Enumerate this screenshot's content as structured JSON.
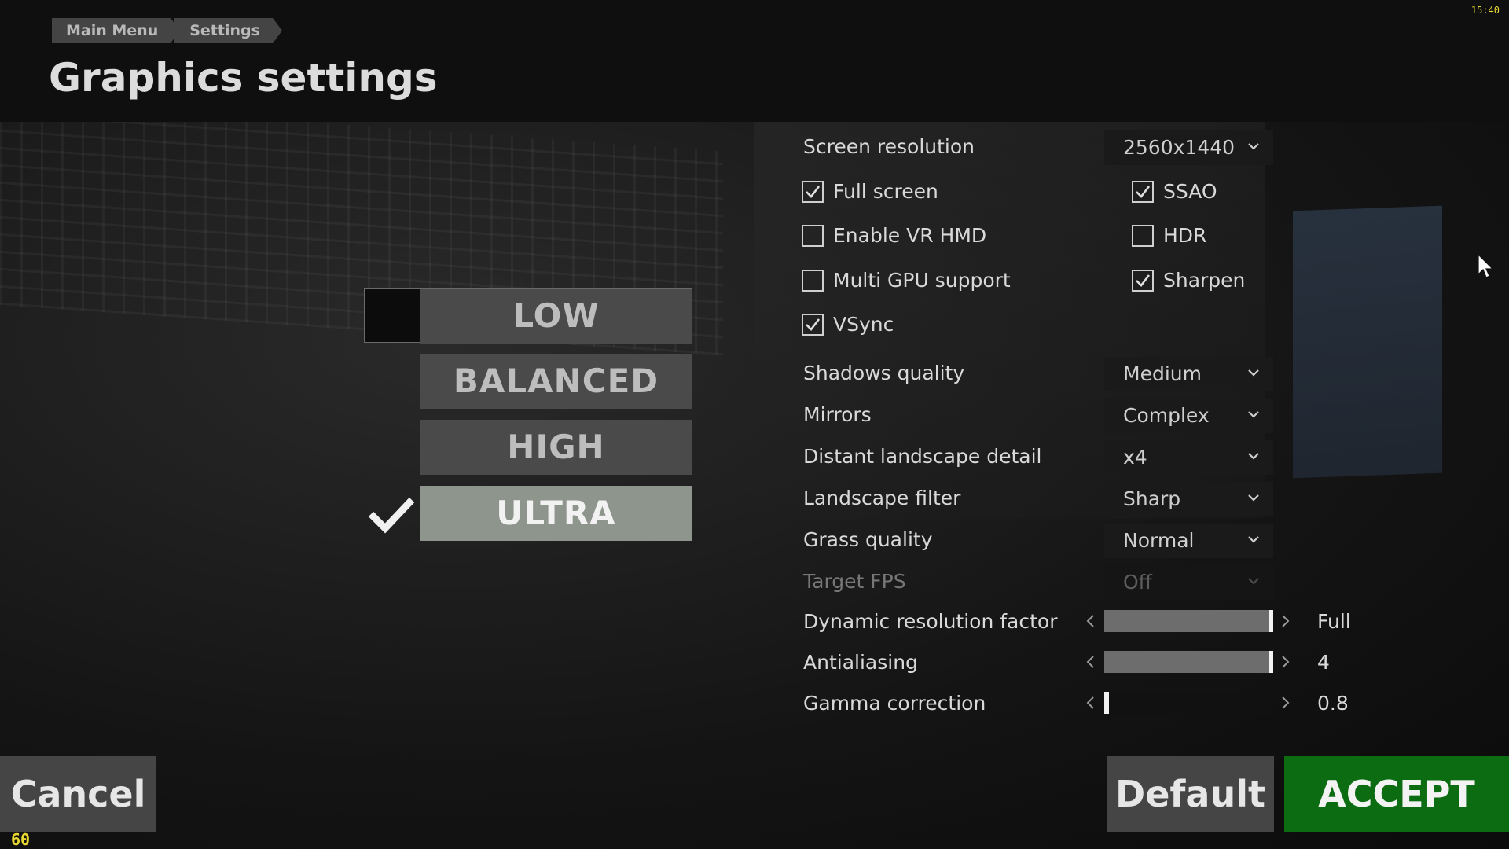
{
  "clock": "15:40",
  "fps": "60",
  "breadcrumb": [
    "Main Menu",
    "Settings"
  ],
  "page_title": "Graphics settings",
  "presets": [
    "LOW",
    "BALANCED",
    "HIGH",
    "ULTRA"
  ],
  "selected_preset": "ULTRA",
  "screen_resolution": {
    "label": "Screen resolution",
    "value": "2560x1440"
  },
  "checkboxes": {
    "full_screen": {
      "label": "Full screen",
      "checked": true
    },
    "enable_vr_hmd": {
      "label": "Enable VR HMD",
      "checked": false
    },
    "multi_gpu": {
      "label": "Multi GPU support",
      "checked": false
    },
    "vsync": {
      "label": "VSync",
      "checked": true
    },
    "ssao": {
      "label": "SSAO",
      "checked": true
    },
    "hdr": {
      "label": "HDR",
      "checked": false
    },
    "sharpen": {
      "label": "Sharpen",
      "checked": true
    }
  },
  "dropdowns": {
    "shadows": {
      "label": "Shadows quality",
      "value": "Medium"
    },
    "mirrors": {
      "label": "Mirrors",
      "value": "Complex"
    },
    "distant_landscape": {
      "label": "Distant landscape detail",
      "value": "x4"
    },
    "landscape_filter": {
      "label": "Landscape filter",
      "value": "Sharp"
    },
    "grass": {
      "label": "Grass quality",
      "value": "Normal"
    },
    "target_fps": {
      "label": "Target FPS",
      "value": "Off",
      "disabled": true
    }
  },
  "sliders": {
    "dynamic_resolution": {
      "label": "Dynamic resolution factor",
      "value": "Full",
      "level": 1.0
    },
    "antialiasing": {
      "label": "Antialiasing",
      "value": "4",
      "level": 1.0
    },
    "gamma": {
      "label": "Gamma correction",
      "value": "0.8",
      "level": 0.0
    }
  },
  "buttons": {
    "cancel": "Cancel",
    "default": "Default",
    "accept": "ACCEPT"
  },
  "colors": {
    "accept": "#0b6c12",
    "indicator": "#e8d630"
  }
}
